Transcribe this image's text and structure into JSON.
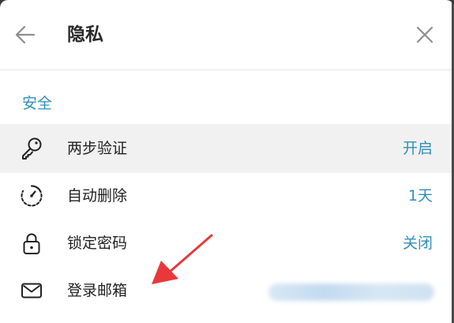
{
  "header": {
    "title": "隐私",
    "back_icon": "arrow-left-icon",
    "close_icon": "close-icon"
  },
  "section": {
    "title": "安全"
  },
  "rows": [
    {
      "label": "两步验证",
      "value": "开启",
      "icon": "key-icon",
      "highlighted": true
    },
    {
      "label": "自动删除",
      "value": "1天",
      "icon": "timer-icon",
      "highlighted": false
    },
    {
      "label": "锁定密码",
      "value": "关闭",
      "icon": "lock-icon",
      "highlighted": false
    },
    {
      "label": "登录邮箱",
      "value": "",
      "icon": "mail-icon",
      "highlighted": false
    }
  ],
  "colors": {
    "accent": "#2f8fb8",
    "annotation_arrow": "#e8383a",
    "highlight_row": "#f1f1f1"
  }
}
